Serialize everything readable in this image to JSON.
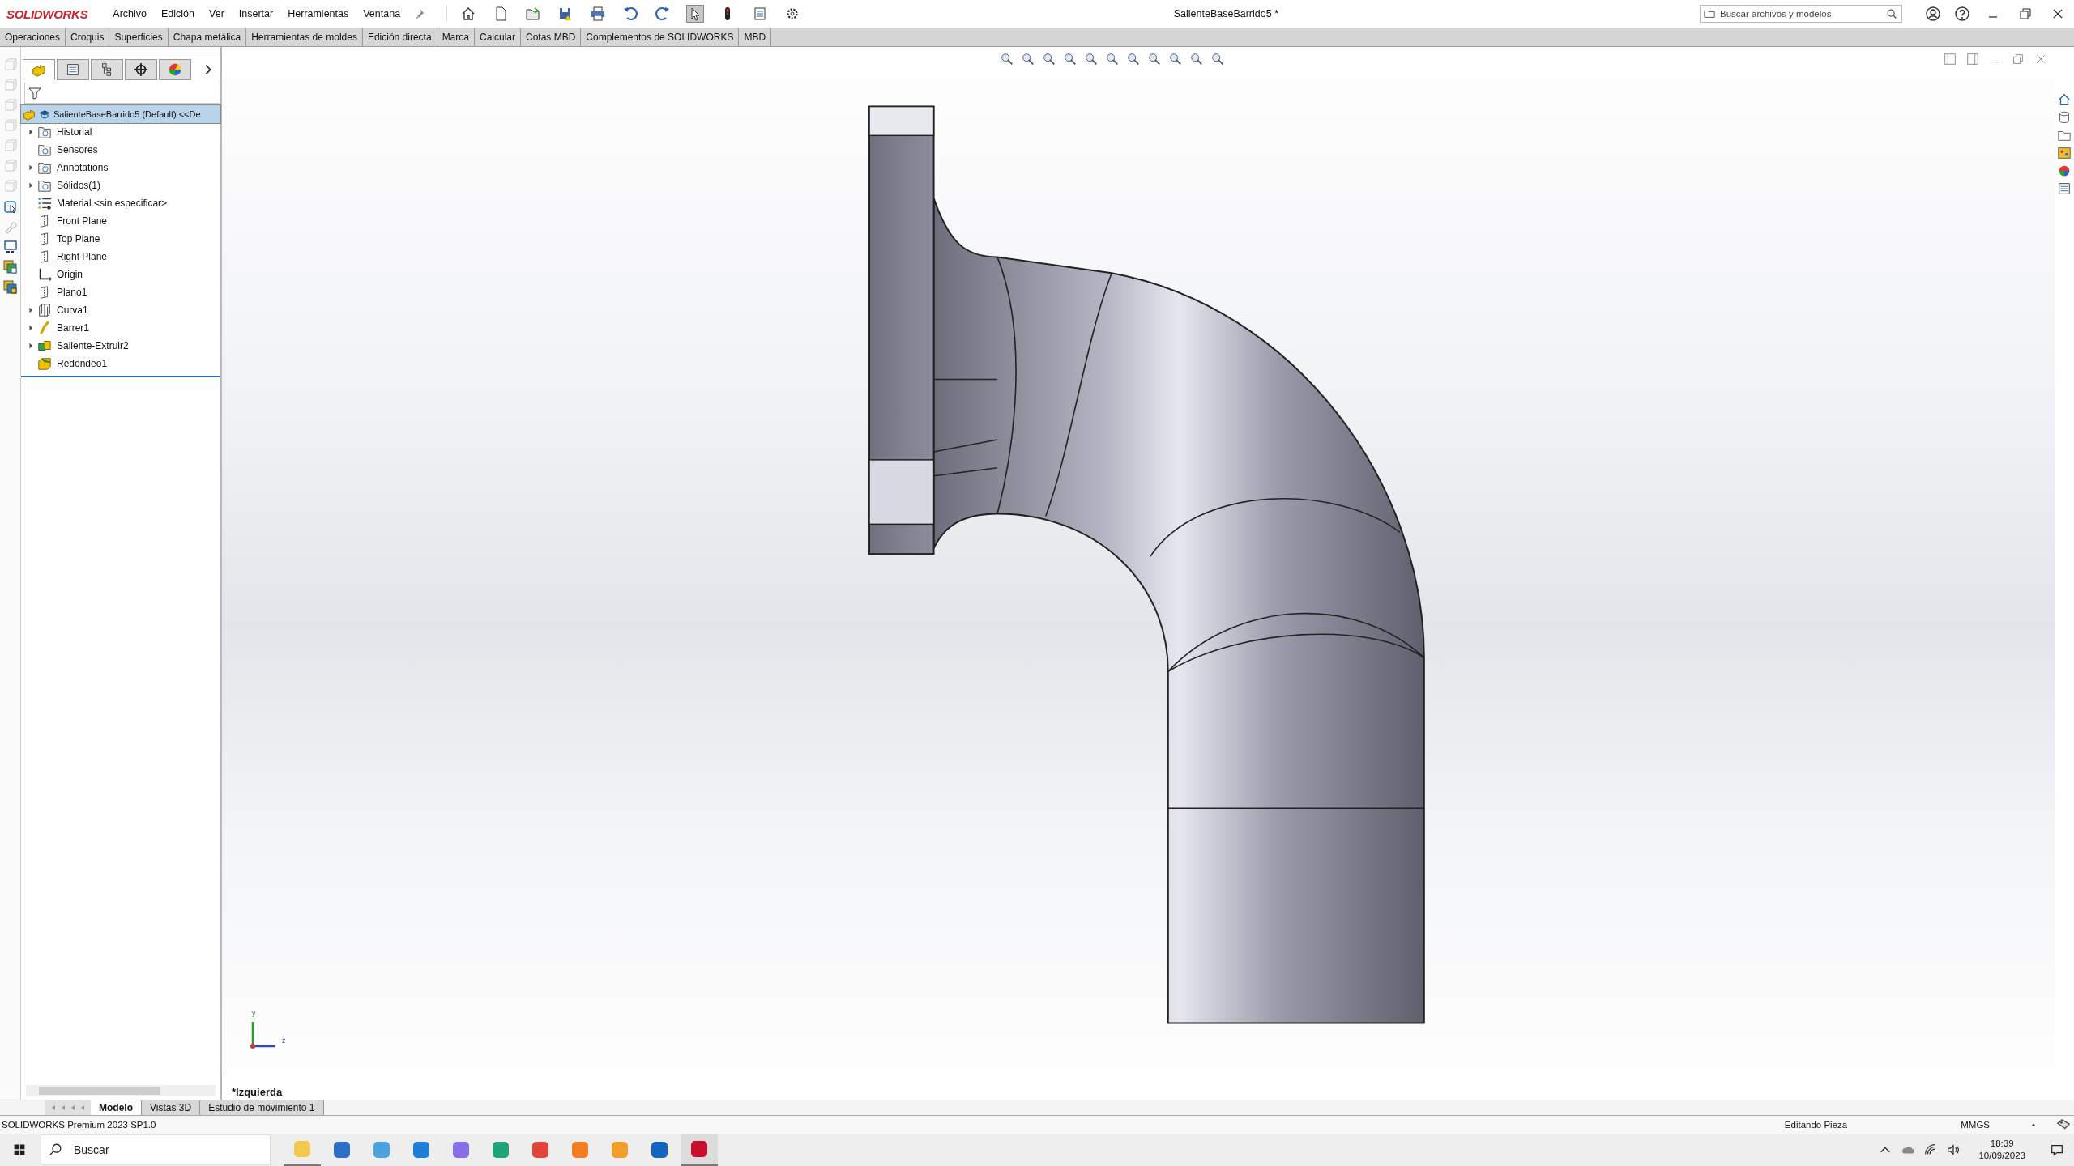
{
  "app": {
    "logo": "SOLIDWORKS",
    "menu": [
      "Archivo",
      "Edición",
      "Ver",
      "Insertar",
      "Herramientas",
      "Ventana"
    ],
    "document_title": "SalienteBaseBarrido5 *",
    "search": {
      "placeholder": "Buscar archivos y modelos"
    }
  },
  "command_tabs": [
    {
      "label": "Operaciones",
      "selected": false
    },
    {
      "label": "Croquis",
      "selected": false
    },
    {
      "label": "Superficies",
      "selected": false
    },
    {
      "label": "Chapa metálica",
      "selected": false
    },
    {
      "label": "Herramientas de moldes",
      "selected": false
    },
    {
      "label": "Edición directa",
      "selected": false
    },
    {
      "label": "Marca",
      "selected": false
    },
    {
      "label": "Calcular",
      "selected": false
    },
    {
      "label": "Cotas MBD",
      "selected": false
    },
    {
      "label": "Complementos de SOLIDWORKS",
      "selected": false
    },
    {
      "label": "MBD",
      "selected": false
    }
  ],
  "feature_manager": {
    "tabs": [
      {
        "kind": "features",
        "selected": true
      },
      {
        "kind": "properties",
        "selected": false
      },
      {
        "kind": "configurations",
        "selected": false
      },
      {
        "kind": "dimxpert",
        "selected": false
      },
      {
        "kind": "display",
        "selected": false
      }
    ],
    "tree": {
      "label": "SalienteBaseBarrido5 (Default) <<De",
      "selected": true,
      "children": [
        {
          "label": "Historial",
          "kind": "folder",
          "expanded": false,
          "selected": false
        },
        {
          "label": "Sensores",
          "kind": "folder",
          "selected": false
        },
        {
          "label": "Annotations",
          "kind": "folder",
          "expanded": false,
          "selected": false
        },
        {
          "label": "Sólidos(1)",
          "kind": "folder",
          "expanded": false,
          "selected": false
        },
        {
          "label": "Material <sin especificar>",
          "kind": "material",
          "selected": false
        },
        {
          "label": "Front Plane",
          "kind": "plane",
          "selected": false
        },
        {
          "label": "Top Plane",
          "kind": "plane",
          "selected": false
        },
        {
          "label": "Right Plane",
          "kind": "plane",
          "selected": false
        },
        {
          "label": "Origin",
          "kind": "origin",
          "selected": false
        },
        {
          "label": "Plano1",
          "kind": "plane",
          "selected": false
        },
        {
          "label": "Curva1",
          "kind": "curve",
          "expanded": false,
          "selected": false
        },
        {
          "label": "Barrer1",
          "kind": "sweep",
          "expanded": false,
          "selected": false
        },
        {
          "label": "Saliente-Extruir2",
          "kind": "extrude",
          "expanded": false,
          "selected": false
        },
        {
          "label": "Redondeo1",
          "kind": "fillet",
          "selected": false
        }
      ]
    }
  },
  "viewport": {
    "view_label": "*Izquierda",
    "triad": [
      "y",
      "z"
    ]
  },
  "bottom_tabs": [
    {
      "label": "Modelo",
      "selected": true
    },
    {
      "label": "Vistas 3D",
      "selected": false
    },
    {
      "label": "Estudio de movimiento 1",
      "selected": false
    }
  ],
  "status_bar": {
    "product": "SOLIDWORKS Premium 2023 SP1.0",
    "mode": "Editando Pieza",
    "units": "MMGS"
  },
  "taskbar": {
    "search": {
      "placeholder": "Buscar"
    },
    "time": "18:39",
    "date": "10/09/2023",
    "apps": [
      {
        "kind": "explorer",
        "running": true,
        "selected": false
      },
      {
        "kind": "store",
        "running": false,
        "selected": false
      },
      {
        "kind": "control-panel",
        "running": false,
        "selected": false
      },
      {
        "kind": "mail",
        "running": false,
        "selected": false
      },
      {
        "kind": "copilot",
        "running": false,
        "selected": false
      },
      {
        "kind": "edge",
        "running": false,
        "selected": false
      },
      {
        "kind": "chrome",
        "running": false,
        "selected": false
      },
      {
        "kind": "firefox",
        "running": false,
        "selected": false
      },
      {
        "kind": "sublime",
        "running": false,
        "selected": false
      },
      {
        "kind": "outlook",
        "running": false,
        "selected": false
      },
      {
        "kind": "solidworks",
        "running": true,
        "selected": true
      }
    ]
  }
}
